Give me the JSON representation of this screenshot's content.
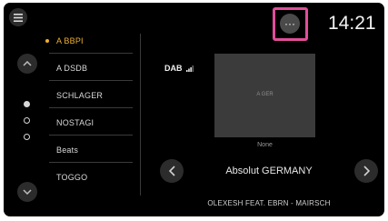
{
  "header": {
    "clock": "14:21",
    "more_glyph": "···"
  },
  "sidebar": {
    "items": [
      {
        "label": "A BBPI",
        "active": true
      },
      {
        "label": "A DSDB",
        "active": false
      },
      {
        "label": "SCHLAGER",
        "active": false
      },
      {
        "label": "NOSTAGI",
        "active": false
      },
      {
        "label": "Beats",
        "active": false
      },
      {
        "label": "TOGGO",
        "active": false
      }
    ],
    "page_indicator": {
      "current": 1,
      "total": 3
    }
  },
  "player": {
    "source": "DAB",
    "art_caption": "A GER",
    "art_subtext": "None",
    "station": "Absolut GERMANY",
    "track": "OLEXESH FEAT. EBRN - MAIRSCH"
  },
  "colors": {
    "accent": "#f0b030",
    "highlight": "#e04e9a",
    "background": "#000000"
  }
}
